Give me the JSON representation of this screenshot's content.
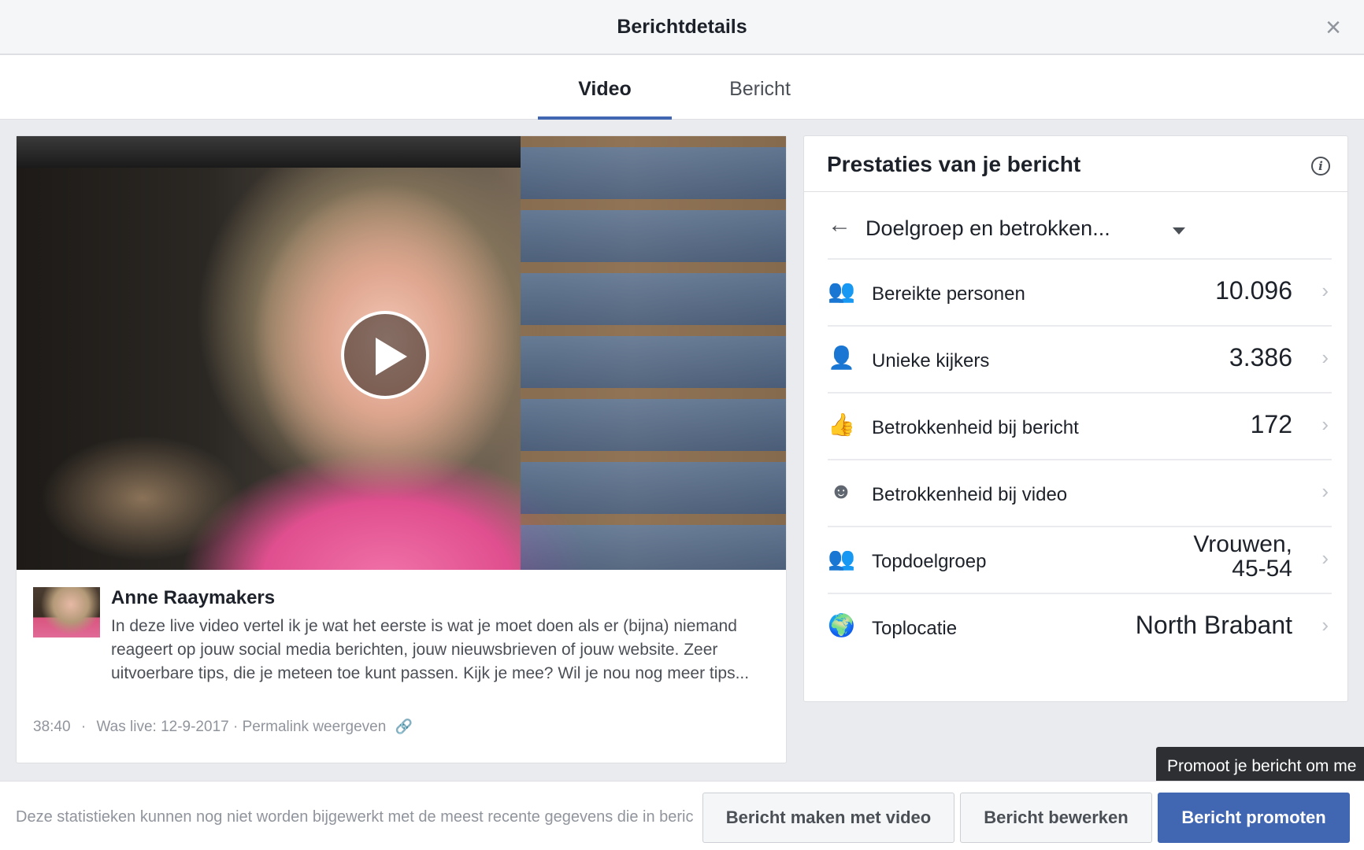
{
  "dialog": {
    "title": "Berichtdetails",
    "close_symbol": "×"
  },
  "tabs": [
    {
      "label": "Video",
      "active": true
    },
    {
      "label": "Bericht",
      "active": false
    }
  ],
  "video": {
    "author": "Anne Raaymakers",
    "description": "In deze live video vertel ik je wat het eerste is wat je moet doen als er (bijna) niemand reageert op jouw social media berichten, jouw nieuwsbrieven of jouw website. Zeer uitvoerbare tips, die je meteen toe kunt passen. Kijk je mee? Wil je nou nog meer tips...",
    "duration": "38:40",
    "separator": "·",
    "live_info": "Was live: 12-9-2017 · Permalink weergeven",
    "link_icon": "link-icon"
  },
  "stats": {
    "title": "Prestaties van je bericht",
    "info_icon": "i",
    "selector": {
      "back_symbol": "←",
      "label": "Doelgroep en betrokken..."
    },
    "metrics": [
      {
        "icon": "people-icon",
        "glyph": "👥",
        "label": "Bereikte personen",
        "value": "10.096"
      },
      {
        "icon": "person-icon",
        "glyph": "👤",
        "label": "Unieke kijkers",
        "value": "3.386"
      },
      {
        "icon": "thumbs-up-icon",
        "glyph": "👍",
        "label": "Betrokkenheid bij bericht",
        "value": "172"
      },
      {
        "icon": "smiley-icon",
        "glyph": "☻",
        "label": "Betrokkenheid bij video",
        "value": ""
      },
      {
        "icon": "group-icon",
        "glyph": "👥",
        "label": "Topdoelgroep",
        "value_line1": "Vrouwen,",
        "value_line2": "45-54"
      },
      {
        "icon": "globe-icon",
        "glyph": "🌍",
        "label": "Toplocatie",
        "value": "North Brabant"
      }
    ],
    "chevron": "›"
  },
  "footer": {
    "note": "Deze statistieken kunnen nog niet worden bijgewerkt met de meest recente gegevens die in beric",
    "buttons": {
      "make_video": "Bericht maken met video",
      "edit": "Bericht bewerken",
      "promote": "Bericht promoten"
    },
    "tooltip": "Promoot je bericht om me"
  },
  "colors": {
    "accent": "#4267b2",
    "header_bg": "#f5f6f7",
    "page_bg": "#e9ebee"
  }
}
